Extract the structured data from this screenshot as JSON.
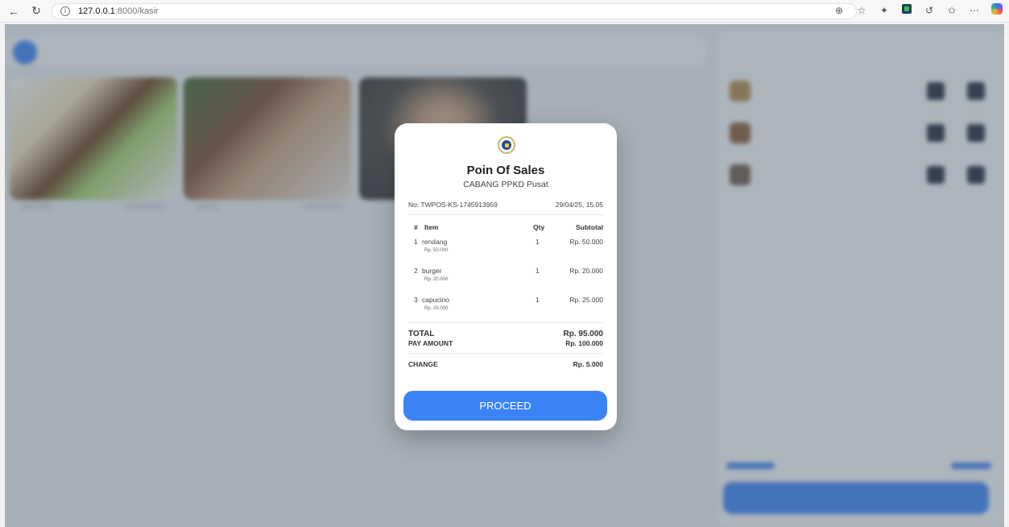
{
  "browser": {
    "url_host": "127.0.0.1",
    "url_path": ":8000/kasir"
  },
  "receipt": {
    "title": "Poin Of Sales",
    "branch": "CABANG PPKD Pusat",
    "number": "No: TWPOS-KS-1745913959",
    "datetime": "29/04/25, 15.05",
    "columns": {
      "no": "#",
      "item": "Item",
      "qty": "Qty",
      "subtotal": "Subtotal"
    },
    "items": [
      {
        "no": "1",
        "name": "rendang",
        "price": "Rp. 50.000",
        "qty": "1",
        "subtotal": "Rp. 50.000"
      },
      {
        "no": "2",
        "name": "burger",
        "price": "Rp. 20.000",
        "qty": "1",
        "subtotal": "Rp. 20.000"
      },
      {
        "no": "3",
        "name": "capucino",
        "price": "Rp. 25.000",
        "qty": "1",
        "subtotal": "Rp. 25.000"
      }
    ],
    "total_label": "TOTAL",
    "total_value": "Rp. 95.000",
    "pay_label": "PAY AMOUNT",
    "pay_value": "Rp. 100.000",
    "change_label": "CHANGE",
    "change_value": "Rp. 5.000",
    "proceed_label": "PROCEED"
  }
}
